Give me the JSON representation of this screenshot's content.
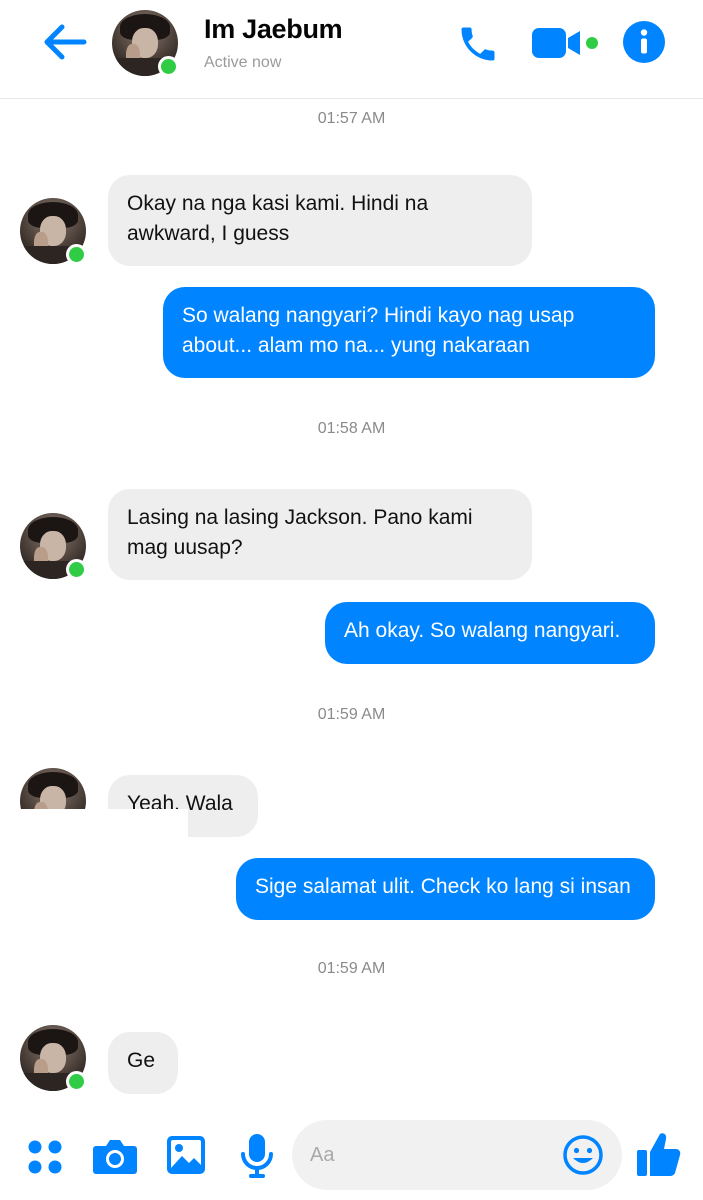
{
  "header": {
    "contact_name": "Im Jaebum",
    "status": "Active now",
    "icons": [
      "back-arrow-icon",
      "phone-icon",
      "video-call-icon",
      "info-icon"
    ],
    "accent_color": "#0084ff"
  },
  "messages": [
    {
      "type": "time",
      "text": "01:57 AM"
    },
    {
      "type": "in",
      "text": "Okay na nga kasi kami. Hindi na\nawkward, I guess"
    },
    {
      "type": "out",
      "text": "So walang nangyari? Hindi kayo nag usap\nabout... alam mo na... yung nakaraan"
    },
    {
      "type": "time",
      "text": "01:58 AM"
    },
    {
      "type": "in",
      "text": "Lasing na lasing Jackson. Pano kami\nmag uusap?"
    },
    {
      "type": "out",
      "text": "Ah okay. So walang nangyari."
    },
    {
      "type": "time",
      "text": "01:59 AM"
    },
    {
      "type": "in",
      "text": "Yeah. Wala"
    },
    {
      "type": "out",
      "text": "Sige salamat ulit. Check ko lang si insan"
    },
    {
      "type": "time",
      "text": "01:59 AM"
    },
    {
      "type": "in",
      "text": "Ge"
    }
  ],
  "composer": {
    "placeholder": "Aa",
    "icons": [
      "apps-icon",
      "camera-icon",
      "gallery-icon",
      "microphone-icon",
      "emoji-icon",
      "like-thumb-icon"
    ]
  }
}
